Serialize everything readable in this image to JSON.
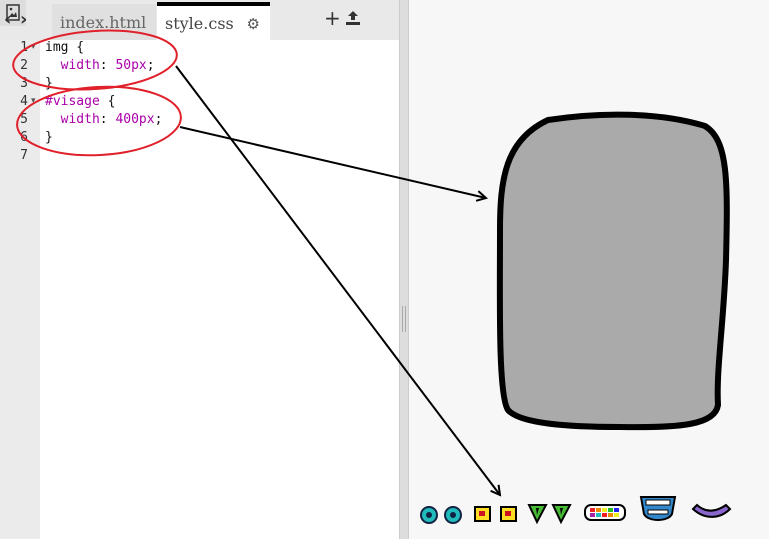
{
  "toolbar": {
    "back_icon": "chevron-left-icon",
    "forward_icon": "chevron-right-icon",
    "add_icon": "plus-icon",
    "upload_icon": "upload-icon",
    "image_icon": "image-icon"
  },
  "tabs": [
    {
      "label": "index.html",
      "active": false
    },
    {
      "label": "style.css",
      "active": true
    }
  ],
  "editor": {
    "line_numbers": [
      "1",
      "2",
      "3",
      "4",
      "5",
      "6",
      "7"
    ],
    "lines": {
      "l1": {
        "selector": "img",
        "brace": " {"
      },
      "l2": {
        "prop": "width",
        "colon": ": ",
        "value": "50px",
        "semi": ";"
      },
      "l3": {
        "brace": "}"
      },
      "l4": {
        "selector": "#visage",
        "brace": " {"
      },
      "l5": {
        "prop": "width",
        "colon": ": ",
        "value": "400px",
        "semi": ";"
      },
      "l6": {
        "brace": "}"
      }
    }
  },
  "colors": {
    "annotation": "#e0202a",
    "face_fill": "#aaaaaa",
    "selector": "#aa00aa"
  }
}
